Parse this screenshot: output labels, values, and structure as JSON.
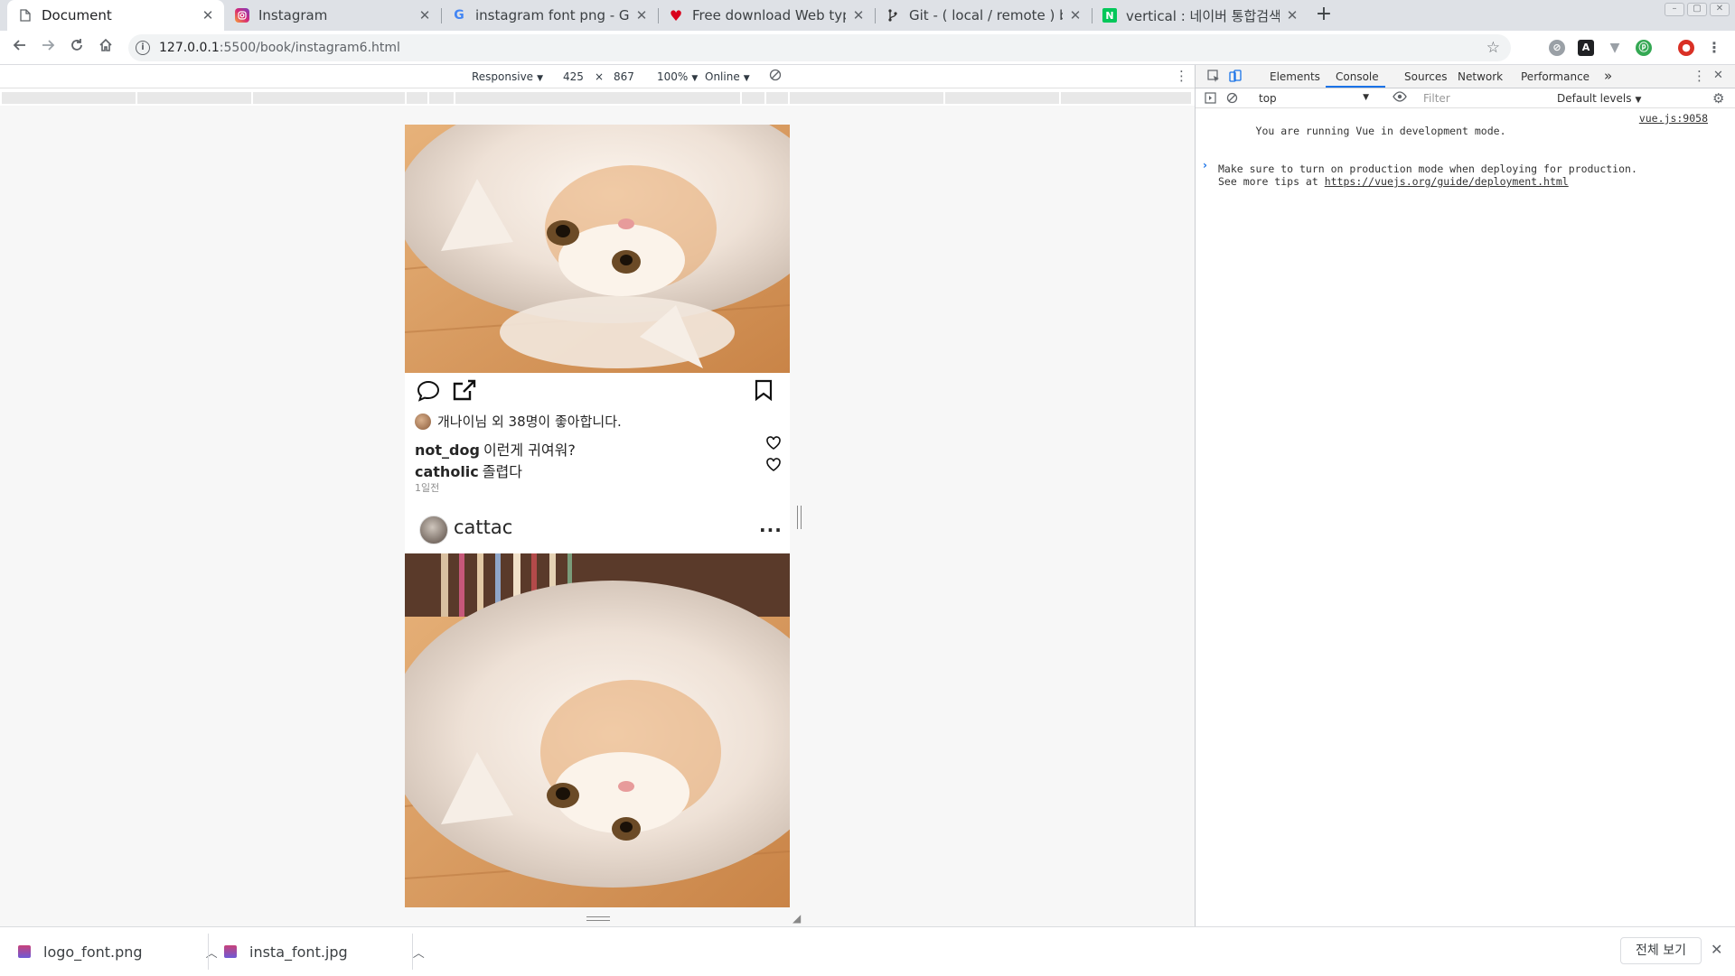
{
  "browser": {
    "tabs": [
      {
        "title": "Document",
        "active": true,
        "icon": "document-icon"
      },
      {
        "title": "Instagram",
        "active": false,
        "icon": "instagram-icon"
      },
      {
        "title": "instagram font png - Goo",
        "active": false,
        "icon": "google-icon"
      },
      {
        "title": "Free download Web typo",
        "active": false,
        "icon": "heart-icon"
      },
      {
        "title": "Git - ( local / remote ) bra",
        "active": false,
        "icon": "git-icon"
      },
      {
        "title": "vertical : 네이버 통합검색",
        "active": false,
        "icon": "naver-icon"
      }
    ],
    "url_host": "127.0.0.1",
    "url_rest": ":5500/book/instagram6.html"
  },
  "device_toolbar": {
    "device": "Responsive",
    "width": "425",
    "times": "×",
    "height": "867",
    "zoom": "100%",
    "network": "Online"
  },
  "post": {
    "likes_text": "개나이님 외 38명이 좋아합니다.",
    "comments": [
      {
        "user": "not_dog",
        "text": "이런게 귀여워?"
      },
      {
        "user": "catholic",
        "text": "졸렵다"
      }
    ],
    "time": "1일전"
  },
  "next_post": {
    "username": "cattac",
    "more": "..."
  },
  "devtools": {
    "tabs": [
      "Elements",
      "Console",
      "Sources",
      "Network",
      "Performance"
    ],
    "overflow": "»",
    "context": "top",
    "filter_placeholder": "Filter",
    "levels": "Default levels",
    "console": {
      "line1": "You are running Vue in development mode.",
      "line2": "Make sure to turn on production mode when deploying for production.",
      "line3_prefix": "See more tips at ",
      "line3_link": "https://vuejs.org/guide/deployment.html",
      "source": "vue.js:9058"
    },
    "prompt": "›"
  },
  "downloads": [
    {
      "name": "logo_font.png"
    },
    {
      "name": "insta_font.jpg"
    }
  ],
  "shelf": {
    "show_all": "전체 보기",
    "close": "✕"
  },
  "colors": {
    "accent": "#1a73e8",
    "tabstrip": "#dee1e6"
  }
}
